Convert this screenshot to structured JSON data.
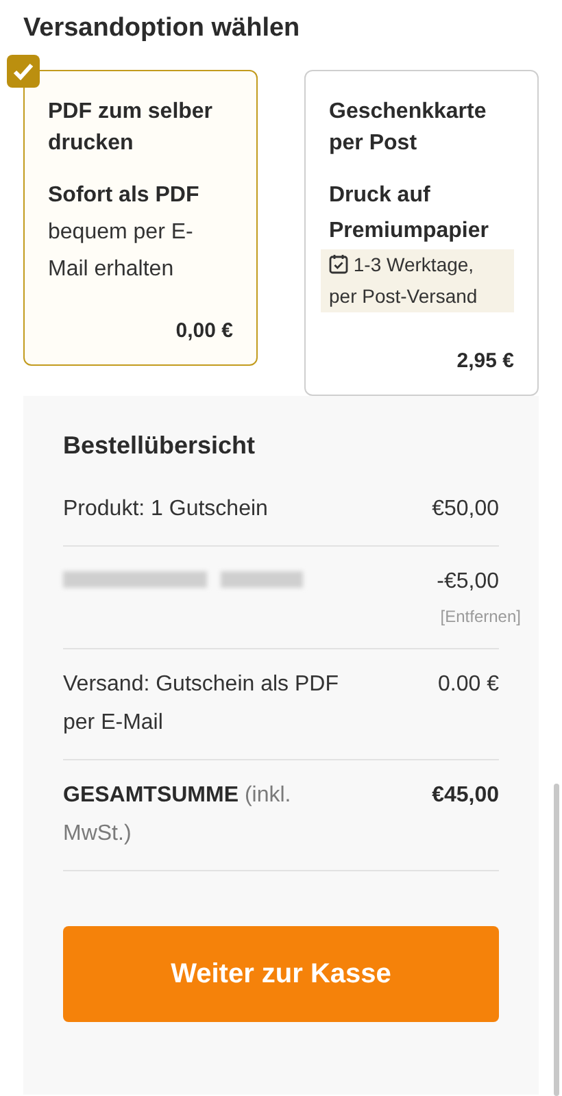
{
  "heading": "Versandoption wählen",
  "options": [
    {
      "title": "PDF zum selber drucken",
      "subtitle": "Sofort als PDF",
      "description": "bequem per E-Mail erhalten",
      "price": "0,00 €",
      "selected": true
    },
    {
      "title": "Geschenkkarte per Post",
      "subtitle": "Druck auf Premiumpapier",
      "note": "1-3 Werktage, per Post-Versand",
      "price": "2,95 €",
      "selected": false
    }
  ],
  "summary": {
    "title": "Bestellübersicht",
    "rows": [
      {
        "kind": "item",
        "label": "Produkt: 1 Gutschein",
        "amount": "€50,00"
      },
      {
        "kind": "redacted",
        "amount": "-€5,00",
        "action": "[Entfernen]"
      },
      {
        "kind": "item",
        "label": "Versand: Gutschein als PDF per E-Mail",
        "amount": "0.00 €"
      },
      {
        "kind": "total",
        "label": "**GESAMTSUMME** (inkl. MwSt.)",
        "amount": "€45,00"
      }
    ]
  },
  "checkout_button": "Weiter zur Kasse"
}
